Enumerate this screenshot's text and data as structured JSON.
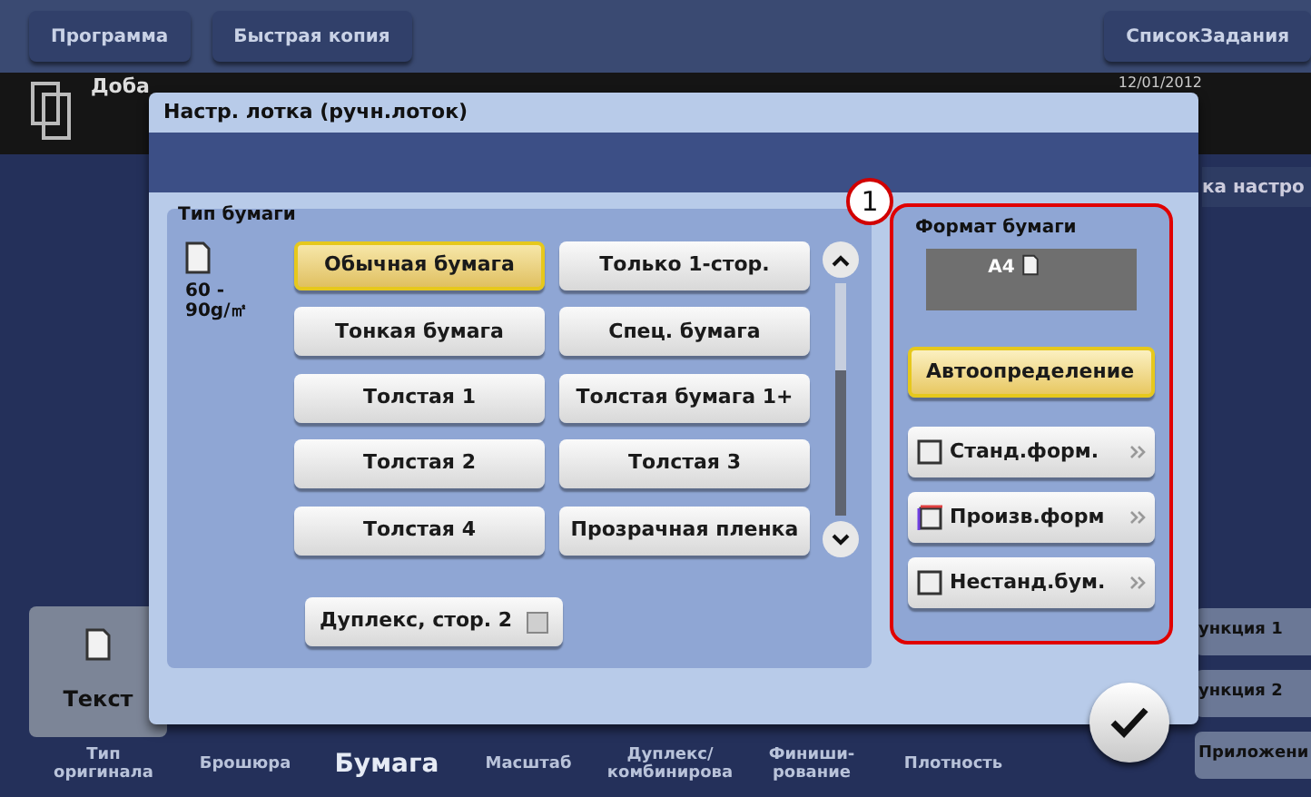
{
  "top_bar": {
    "buttons": [
      {
        "label": "Программа"
      },
      {
        "label": "Быстрая копия"
      },
      {
        "label": "СписокЗадания"
      }
    ]
  },
  "status": {
    "message": "Доба",
    "date": "12/01/2012",
    "side_label": "ка настро"
  },
  "side_buttons": [
    {
      "label": "ункция 1"
    },
    {
      "label": "ункция 2"
    },
    {
      "label": "Приложени"
    }
  ],
  "original_tile": {
    "label": "Текст"
  },
  "bottom_tabs": [
    {
      "label": "Тип оригинала",
      "selected": false
    },
    {
      "label": "Брошюра",
      "selected": false
    },
    {
      "label": "Бумага",
      "selected": true
    },
    {
      "label": "Масштаб",
      "selected": false
    },
    {
      "label": "Дуплекс/ комбинирова",
      "selected": false
    },
    {
      "label": "Финиши- рование",
      "selected": false
    },
    {
      "label": "Плотность",
      "selected": false
    }
  ],
  "dialog": {
    "title": "Настр. лотка (ручн.лоток)",
    "paper_type": {
      "heading": "Тип бумаги",
      "weight_lines": [
        "60 -",
        "90g/㎡"
      ],
      "options": [
        {
          "label": "Обычная бумага",
          "selected": true
        },
        {
          "label": "Только 1-стор.",
          "selected": false
        },
        {
          "label": "Тонкая бумага",
          "selected": false
        },
        {
          "label": "Спец. бумага",
          "selected": false
        },
        {
          "label": "Толстая 1",
          "selected": false
        },
        {
          "label": "Толстая бумага 1+",
          "selected": false
        },
        {
          "label": "Толстая 2",
          "selected": false
        },
        {
          "label": "Толстая 3",
          "selected": false
        },
        {
          "label": "Толстая 4",
          "selected": false
        },
        {
          "label": "Прозрачная пленка",
          "selected": false
        }
      ],
      "duplex": {
        "label": "Дуплекс, стор. 2",
        "checked": false
      }
    },
    "callout": "1",
    "paper_size": {
      "heading": "Формат бумаги",
      "display": "A4",
      "auto": {
        "label": "Автоопределение",
        "selected": true
      },
      "options": [
        {
          "label": "Станд.форм.",
          "kind": "standard"
        },
        {
          "label": "Произв.форм",
          "kind": "custom"
        },
        {
          "label": "Нестанд.бум.",
          "kind": "nonstandard"
        }
      ]
    }
  }
}
